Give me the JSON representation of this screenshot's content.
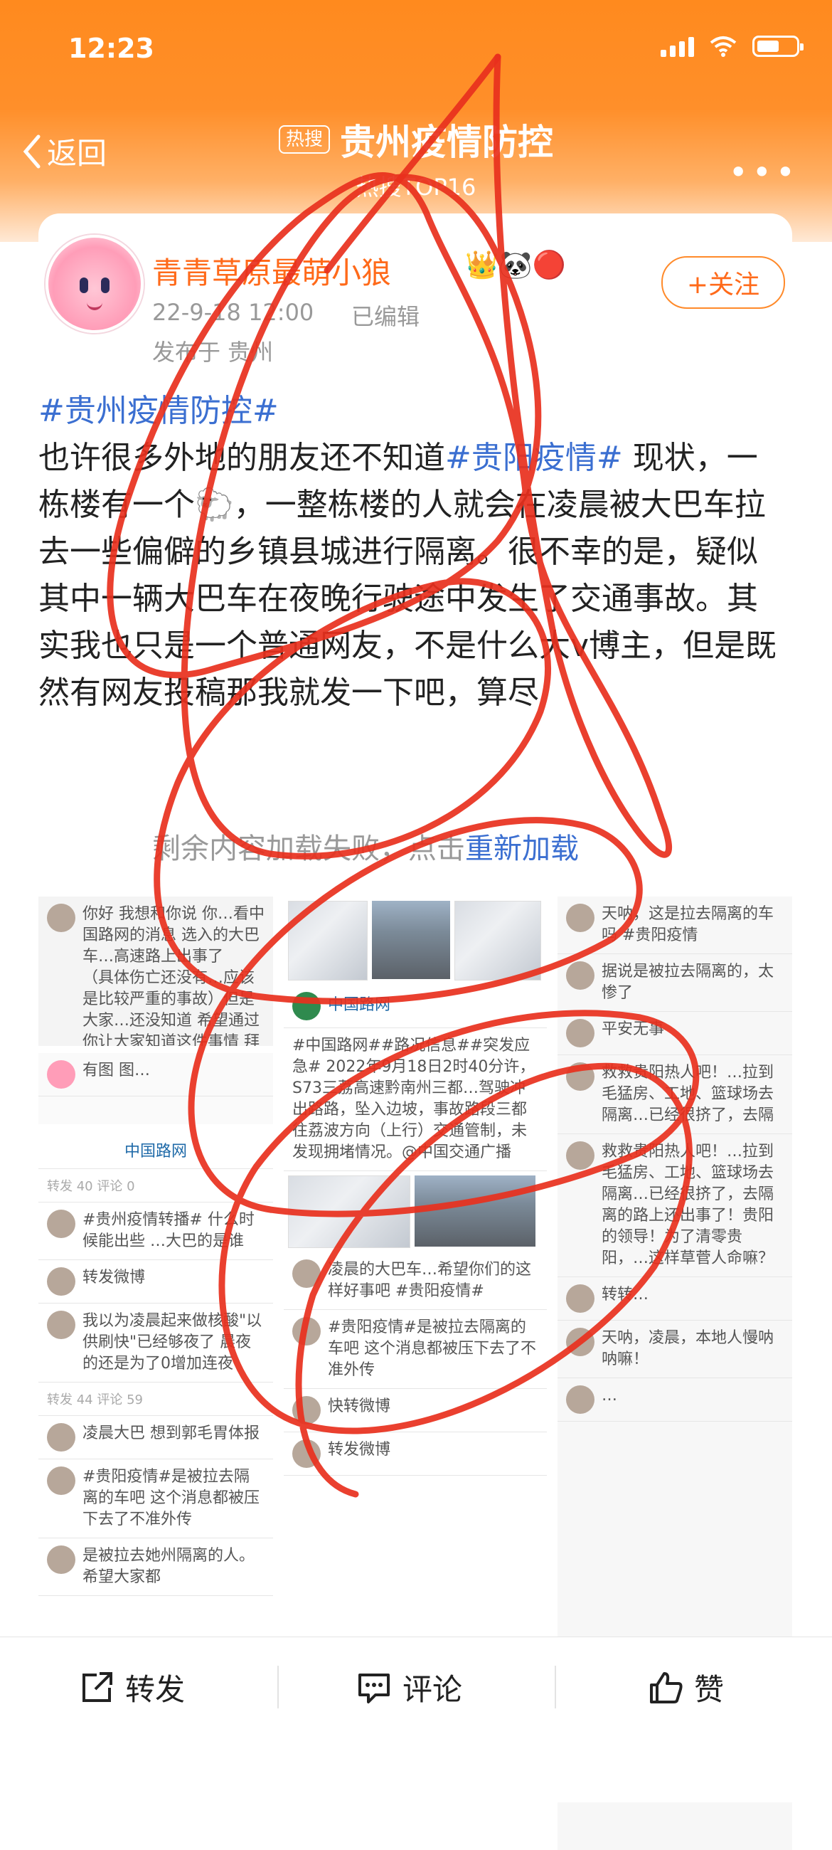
{
  "status_bar": {
    "time": "12:23"
  },
  "nav": {
    "back_label": "返回",
    "hot_badge": "热搜",
    "title": "贵州疫情防控",
    "subtitle": "热搜TOP16"
  },
  "post": {
    "username": "青青草原最萌小狼",
    "badges": "👑🐼🔴",
    "time": "22-9-18 12:00",
    "edited": "已编辑",
    "location": "发布于 贵州",
    "follow_label": "+关注",
    "tag_main": "#贵州疫情防控#",
    "body_1": "也许很多外地的朋友还不知道",
    "tag_inline": "#贵阳疫情#",
    "body_2": " 现状，一栋楼有一个🐑，一整栋楼的人就会在凌晨被大巴车拉去一些偏僻的乡镇县城进行隔离。很不幸的是，疑似其中一辆大巴车在夜晚行驶途中发生了交通事故。其实我也只是一个普通网友，不是什么大v博主，但是既然有网友投稿那我就发一下吧，算尽",
    "load_failed": "剩余内容加载失败，点击",
    "reload": "重新加载"
  },
  "collage": {
    "left_top": [
      "你好 我想和你说 你…看中国路网的消息 选入的大巴车…高速路上出事了",
      "（具体伤亡还没有…应该是比较严重的事故）但是大家…还没知道 希望通过你让大家知道这件事情 拜托拜托"
    ],
    "left_mid": "有图 图…",
    "repost_title": "中国路网",
    "repost_tabs": "转发 40   评论 0",
    "left_rows": [
      "#贵州疫情转播# 什么时候能出些 …大巴的是谁",
      "转发微博",
      "我以为凌晨起来做核酸\"以供刷快\"已经够夜了 晨夜的还是为了0增加连夜"
    ],
    "left_tabs2": "转发 44   评论 59",
    "left_rows2": [
      "凌晨大巴 想到郭毛胃体报",
      "#贵阳疫情#是被拉去隔离的车吧 这个消息都被压下去了不准外传",
      "是被拉去她州隔离的人。希望大家都"
    ],
    "mid_source": "中国路网",
    "mid_text": "#中国路网##路况信息##突发应急# 2022年9月18日2时40分许，S73三荔高速黔南州三都…驾驶冲出路路，坠入边坡，事故路段三都往荔波方向（上行）交通管制，未发现拥堵情况。@中国交通广播",
    "mid_rows": [
      "凌晨的大巴车…希望你们的这样好事吧 #贵阳疫情#",
      "#贵阳疫情#是被拉去隔离的车吧 这个消息都被压下去了不准外传",
      "快转微博",
      "转发微博"
    ],
    "right_rows": [
      "天呐，这是拉去隔离的车吗 #贵阳疫情",
      "据说是被拉去隔离的，太惨了",
      "平安无事",
      "救救贵阳热人吧！…拉到毛猛房、工地、篮球场去隔离…已经很挤了，去隔",
      "救救贵阳热人吧！…拉到毛猛房、工地、篮球场去隔离…已经很挤了，去隔离的路上还出事了！贵阳的领导！为了清零贵阳，…这样草菅人命嘛？",
      "转转…",
      "天呐，凌晨，本地人慢呐呐嘛！",
      "…"
    ]
  },
  "toolbar": {
    "repost": "转发",
    "comment": "评论",
    "like": "赞"
  },
  "colors": {
    "brand_orange": "#ff8a1e",
    "link_blue": "#3b6fd1",
    "scribble_red": "#e8301d"
  }
}
